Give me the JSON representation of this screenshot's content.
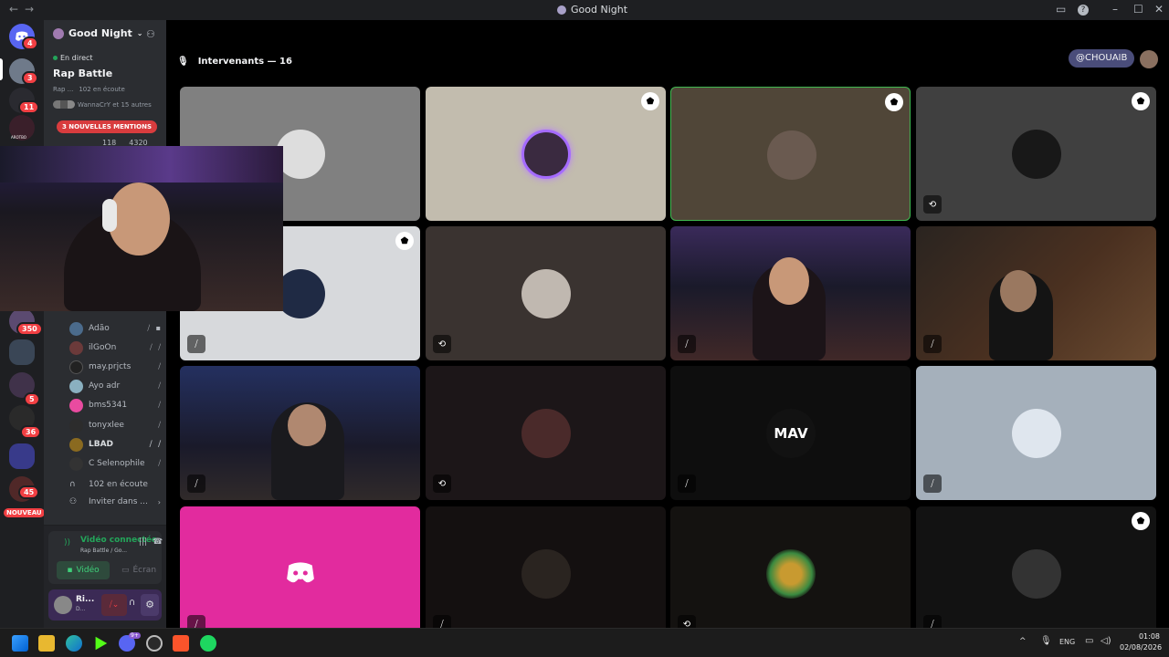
{
  "window": {
    "title": "Good Night",
    "nav_back": "←",
    "nav_forward": "→"
  },
  "server_rail": {
    "badges": [
      "4",
      "3",
      "11",
      "350",
      "5",
      "36",
      "45"
    ],
    "new_label": "NOUVEAU",
    "live_label": "AROTBO"
  },
  "guild": {
    "name": "Good Night",
    "live_status": "En direct",
    "event_name": "Rap Battle",
    "event_sub": "Rap ...",
    "listening": "102 en écoute",
    "listeners_text": "WannaCrY et 15 autres",
    "mentions_pill": "3 NOUVELLES MENTIONS",
    "stream_counts": [
      "118",
      "4320"
    ]
  },
  "members": [
    {
      "name": "Adão"
    },
    {
      "name": "ilGoOn"
    },
    {
      "name": "may.prjcts"
    },
    {
      "name": "Ayo adr"
    },
    {
      "name": "bms5341"
    },
    {
      "name": "tonyxlee"
    },
    {
      "name": "LBAD"
    },
    {
      "name": "C Selenophile"
    }
  ],
  "listening_footer": "102 en écoute",
  "invite_label": "Inviter dans ...",
  "voice_panel": {
    "status": "Vidéo connectée",
    "location": "Rap Battle / Go...",
    "video_btn": "Vidéo",
    "screen_btn": "Écran"
  },
  "user_panel": {
    "name": "Ri...",
    "sub": "D..."
  },
  "stage": {
    "header": "Intervenants — 16",
    "user_tag": "@CHOUAIB"
  },
  "tiles_overlay_text": [
    "MAV"
  ],
  "taskbar": {
    "lang": "ENG",
    "time": "01:08",
    "date": "02/08/2026",
    "notif_badge": "9+"
  },
  "colors": {
    "accent": "#5865f2",
    "live_green": "#23a55a",
    "badge_red": "#f23f43",
    "pink_tile": "#e22b9e"
  }
}
